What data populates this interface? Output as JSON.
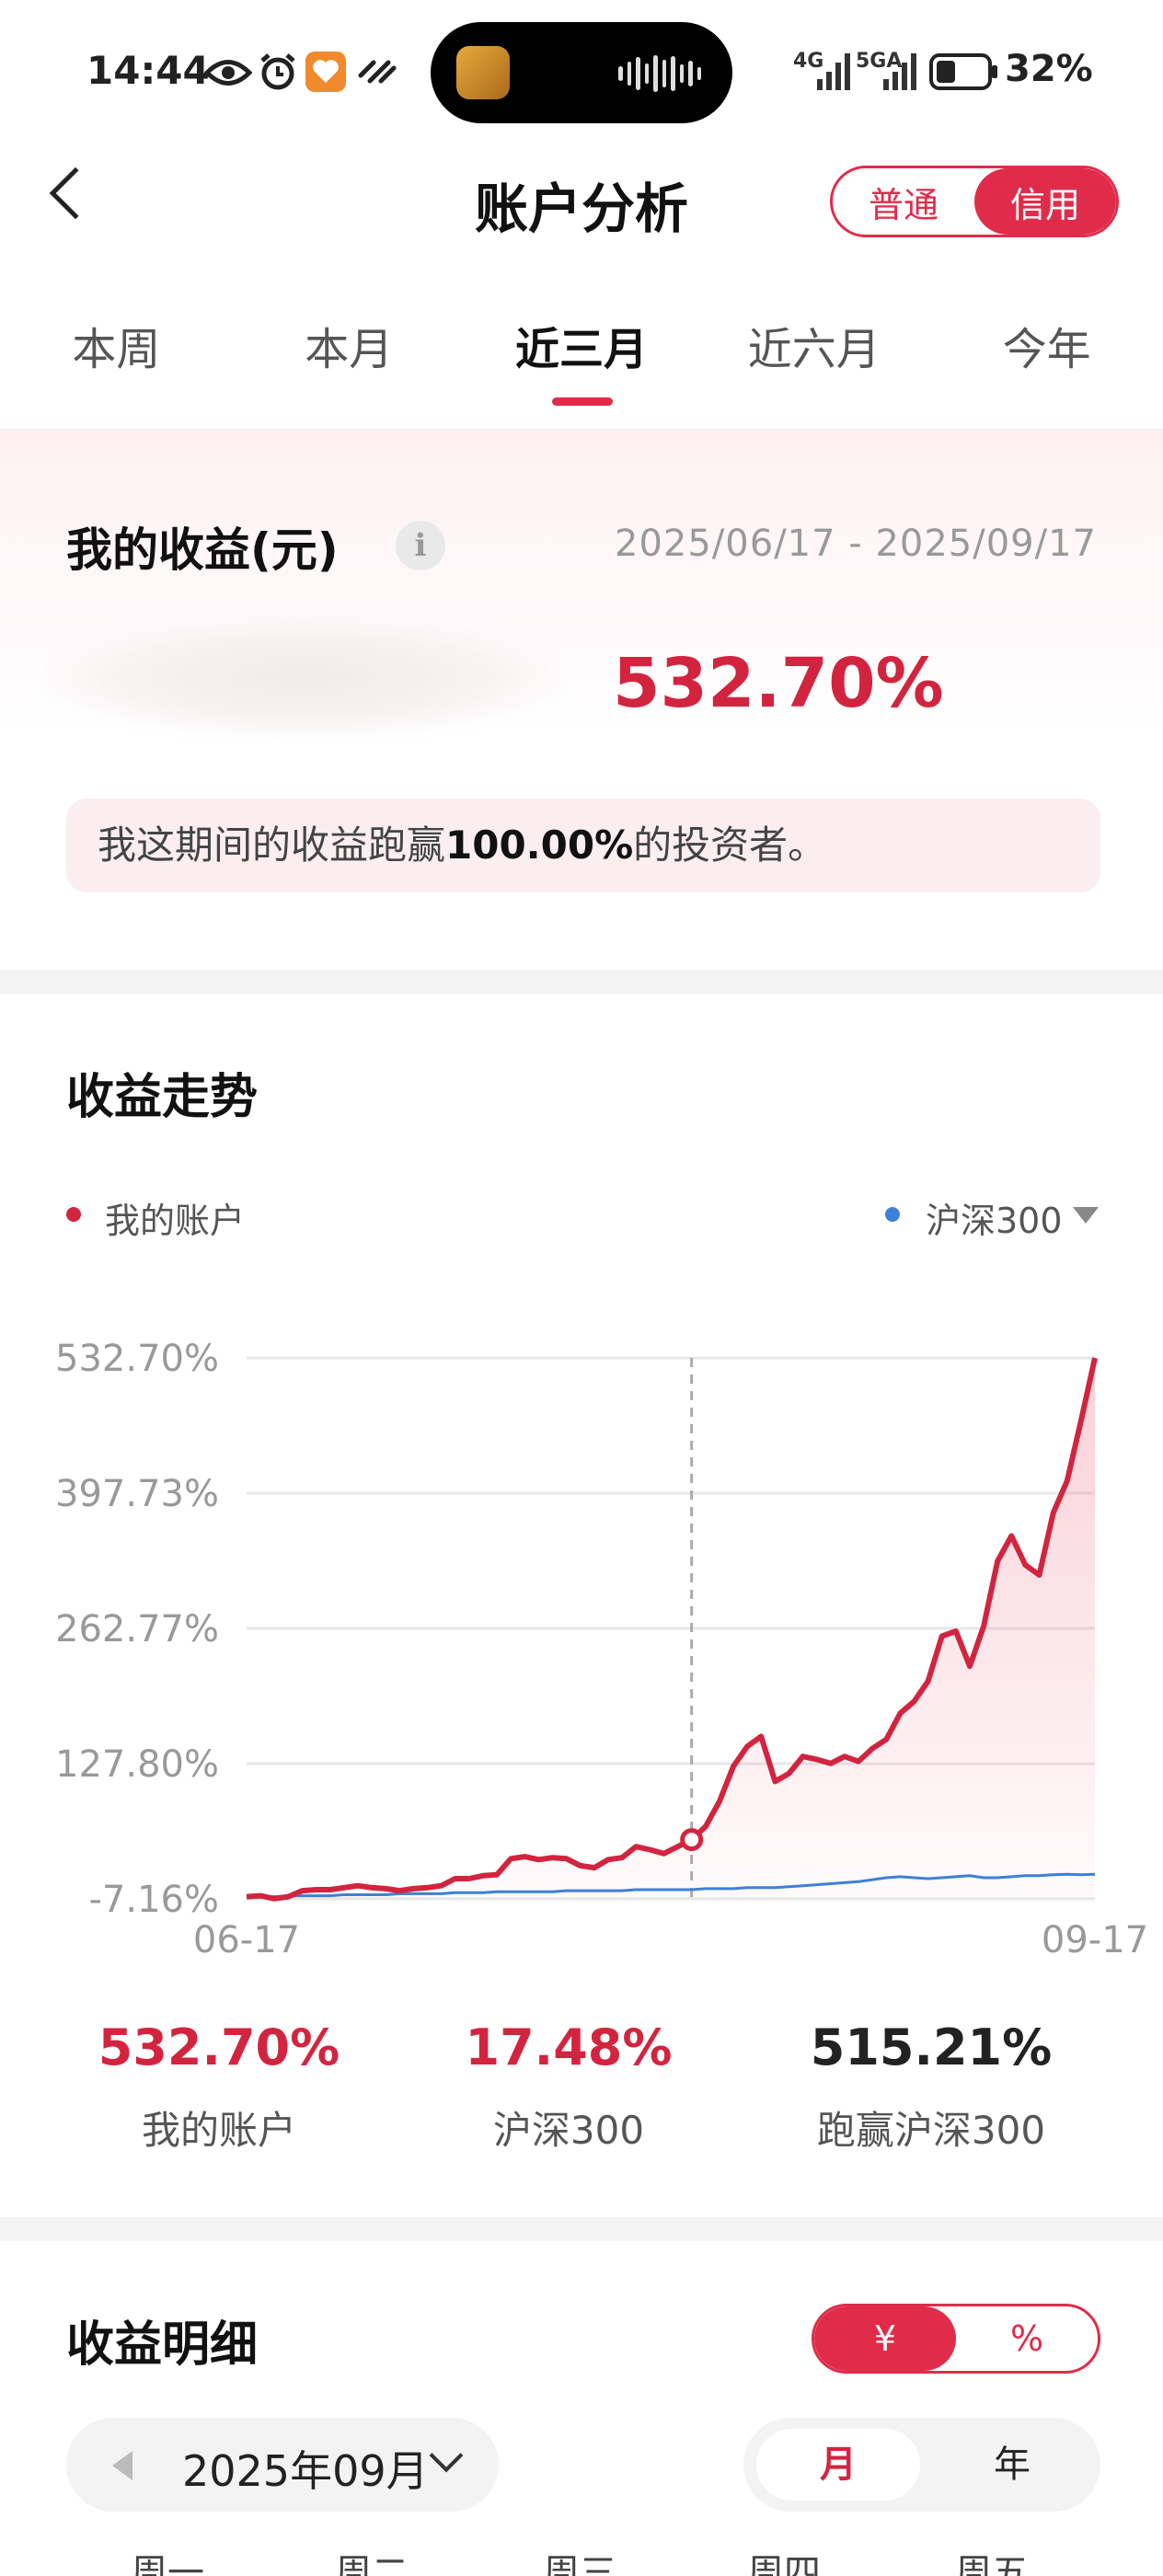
{
  "status_bar": {
    "time": "14:44",
    "network": [
      "4G",
      "5GA"
    ],
    "battery": "32%"
  },
  "header": {
    "title": "账户分析",
    "account_types": [
      {
        "label": "普通",
        "active": false
      },
      {
        "label": "信用",
        "active": true
      }
    ]
  },
  "tabs": [
    {
      "label": "本周",
      "active": false
    },
    {
      "label": "本月",
      "active": false
    },
    {
      "label": "近三月",
      "active": true
    },
    {
      "label": "近六月",
      "active": false
    },
    {
      "label": "今年",
      "active": false
    }
  ],
  "profit": {
    "title": "我的收益(元)",
    "info": "i",
    "date_range": "2025/06/17 - 2025/09/17",
    "return_pct": "532.70%",
    "rank_prefix": "我这期间的收益跑赢",
    "rank_value": "100.00%",
    "rank_suffix": "的投资者。"
  },
  "trend": {
    "title": "收益走势",
    "legend_mine": "我的账户",
    "legend_index": "沪深300",
    "colors": {
      "mine": "#d3243f",
      "index": "#3f7fd8"
    }
  },
  "chart_data": {
    "type": "line",
    "y_ticks": [
      "532.70%",
      "397.73%",
      "262.77%",
      "127.80%",
      "-7.16%"
    ],
    "ylim": [
      -7.16,
      532.7
    ],
    "x_tick_labels": [
      "06-17",
      "09-17"
    ],
    "grid": true,
    "series": [
      {
        "name": "我的账户",
        "values": [
          -5,
          -4,
          -7,
          -5,
          1,
          2,
          2,
          4,
          6,
          4,
          3,
          1,
          3,
          4,
          6,
          13,
          13,
          16,
          17,
          33,
          35,
          32,
          34,
          33,
          26,
          24,
          32,
          34,
          45,
          42,
          38,
          45,
          52,
          65,
          90,
          125,
          145,
          155,
          110,
          118,
          135,
          132,
          128,
          135,
          130,
          143,
          152,
          178,
          190,
          210,
          255,
          260,
          225,
          265,
          330,
          355,
          326,
          316,
          378,
          410,
          470,
          532.7
        ]
      },
      {
        "name": "沪深300",
        "values": [
          -5,
          -5,
          -5,
          -4,
          -4,
          -4,
          -4,
          -3,
          -3,
          -3,
          -3,
          -2,
          -2,
          -2,
          -2,
          -1,
          -1,
          -1,
          0,
          0,
          0,
          0,
          0,
          1,
          1,
          1,
          1,
          1,
          2,
          2,
          2,
          2,
          2,
          3,
          3,
          3,
          4,
          4,
          4,
          5,
          6,
          7,
          8,
          9,
          10,
          12,
          14,
          15,
          14,
          13,
          14,
          15,
          16,
          14,
          14,
          15,
          16,
          16,
          17,
          17.48,
          17,
          17.48
        ]
      }
    ],
    "crosshair_value": 45
  },
  "stats": [
    {
      "value": "532.70%",
      "label": "我的账户",
      "color": "#d3243f"
    },
    {
      "value": "17.48%",
      "label": "沪深300",
      "color": "#d3243f"
    },
    {
      "value": "515.21%",
      "label": "跑赢沪深300",
      "color": "#222222"
    }
  ],
  "details": {
    "title": "收益明细",
    "unit_options": [
      {
        "label": "¥",
        "active": true
      },
      {
        "label": "%",
        "active": false
      }
    ],
    "month": "2025年09月",
    "period_options": [
      {
        "label": "月",
        "active": true
      },
      {
        "label": "年",
        "active": false
      }
    ],
    "weekdays": [
      "周一",
      "周二",
      "周三",
      "周四",
      "周五"
    ]
  }
}
